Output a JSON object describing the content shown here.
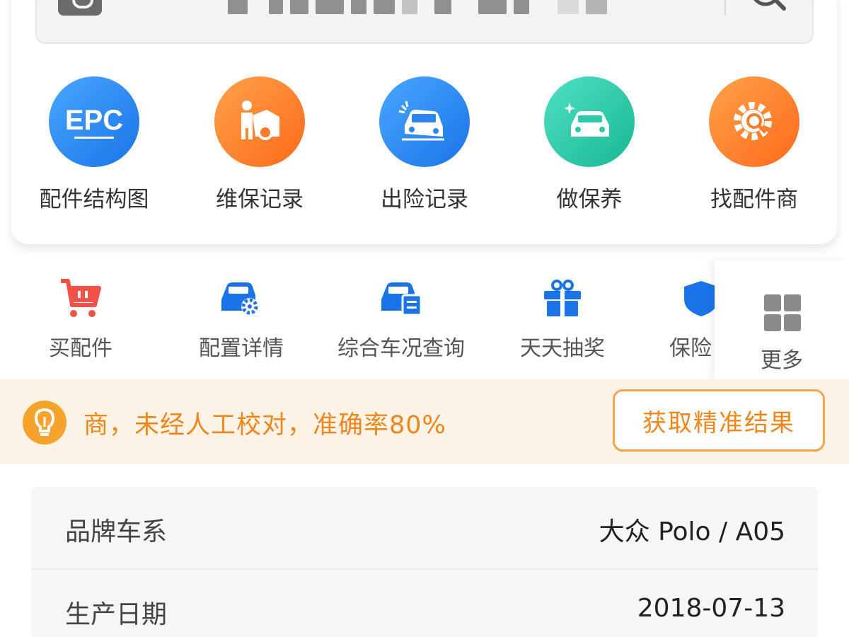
{
  "search": {
    "vin_obscured": true
  },
  "main_tools": [
    {
      "label": "配件结构图",
      "icon": "epc-icon",
      "color": "#1a74e8",
      "icon_text": "EPC"
    },
    {
      "label": "维保记录",
      "icon": "mechanic-repair-icon",
      "color": "#ff6a1a"
    },
    {
      "label": "出险记录",
      "icon": "car-accident-icon",
      "color": "#1a74e8"
    },
    {
      "label": "做保养",
      "icon": "car-wash-icon",
      "color": "#18b894"
    },
    {
      "label": "找配件商",
      "icon": "gear-search-icon",
      "color": "#ff6a1a"
    }
  ],
  "sub_tools": [
    {
      "label": "买配件",
      "icon": "shopping-cart-icon",
      "color": "#f0524a"
    },
    {
      "label": "配置详情",
      "icon": "car-config-icon",
      "color": "#1a74e8"
    },
    {
      "label": "综合车况查询",
      "icon": "car-report-icon",
      "color": "#1a74e8"
    },
    {
      "label": "天天抽奖",
      "icon": "gift-icon",
      "color": "#1a74e8"
    },
    {
      "label": "保险日",
      "icon": "insurance-shield-icon",
      "color": "#1a74e8"
    }
  ],
  "more": {
    "label": "更多",
    "icon": "grid-icon"
  },
  "notice": {
    "icon": "lightbulb-icon",
    "text": "商，未经人工校对，准确率80%",
    "button_label": "获取精准结果",
    "accent": "#f0861a"
  },
  "vehicle_info": [
    {
      "label": "品牌车系",
      "value": "大众 Polo / A05"
    },
    {
      "label": "生产日期",
      "value": "2018-07-13"
    }
  ]
}
